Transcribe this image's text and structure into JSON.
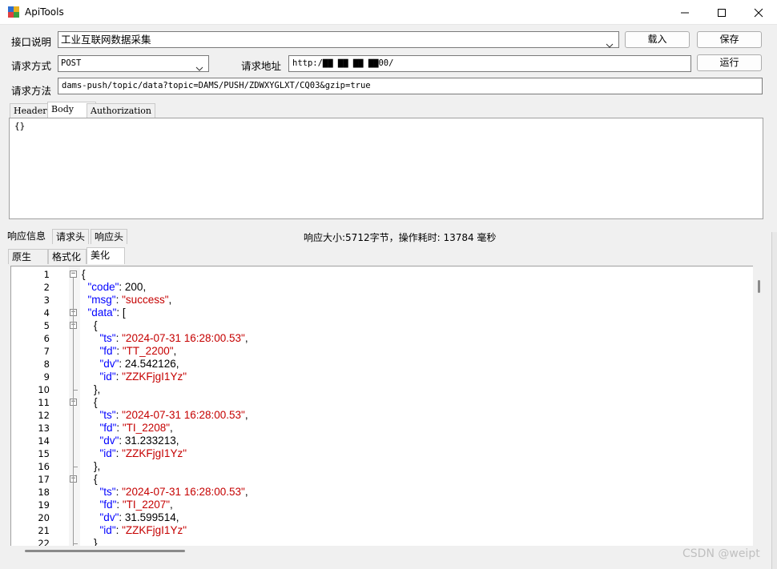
{
  "window": {
    "title": "ApiTools",
    "controls": [
      "minimize-icon",
      "maximize-icon",
      "close-icon"
    ]
  },
  "form": {
    "interface_desc_label": "接口说明",
    "interface_desc_value": "工业互联网数据采集",
    "method_label": "请求方式",
    "method_value": "POST",
    "url_label": "请求地址",
    "url_value": "http:/▇▇ ▇▇ ▇▇ ▇▇00/",
    "path_label": "请求方法",
    "path_value": "dams-push/topic/data?topic=DAMS/PUSH/ZDWXYGLXT/CQ03&gzip=true",
    "load_button": "载入",
    "save_button": "保存",
    "run_button": "运行"
  },
  "request_tabs": [
    {
      "label": "Header",
      "active": false
    },
    {
      "label": "Body",
      "active": true
    },
    {
      "label": "Authorization",
      "active": false
    }
  ],
  "request_body": "{}",
  "response_tabs": [
    {
      "label": "响应信息",
      "active": true
    },
    {
      "label": "请求头",
      "active": false
    },
    {
      "label": "响应头",
      "active": false
    }
  ],
  "response_status": "响应大小:5712字节，操作耗时: 13784 毫秒",
  "view_tabs": [
    {
      "label": "原生",
      "active": false
    },
    {
      "label": "格式化",
      "active": false
    },
    {
      "label": "美化",
      "active": true
    }
  ],
  "code_lines": [
    {
      "n": "1",
      "text": "{"
    },
    {
      "n": "2",
      "text": "  \"code\": 200,"
    },
    {
      "n": "3",
      "text": "  \"msg\": \"success\","
    },
    {
      "n": "4",
      "text": "  \"data\": ["
    },
    {
      "n": "5",
      "text": "    {"
    },
    {
      "n": "6",
      "text": "      \"ts\": \"2024-07-31 16:28:00.53\","
    },
    {
      "n": "7",
      "text": "      \"fd\": \"TT_2200\","
    },
    {
      "n": "8",
      "text": "      \"dv\": 24.542126,"
    },
    {
      "n": "9",
      "text": "      \"id\": \"ZZKFjgI1Yz\""
    },
    {
      "n": "10",
      "text": "    },"
    },
    {
      "n": "11",
      "text": "    {"
    },
    {
      "n": "12",
      "text": "      \"ts\": \"2024-07-31 16:28:00.53\","
    },
    {
      "n": "13",
      "text": "      \"fd\": \"TI_2208\","
    },
    {
      "n": "14",
      "text": "      \"dv\": 31.233213,"
    },
    {
      "n": "15",
      "text": "      \"id\": \"ZZKFjgI1Yz\""
    },
    {
      "n": "16",
      "text": "    },"
    },
    {
      "n": "17",
      "text": "    {"
    },
    {
      "n": "18",
      "text": "      \"ts\": \"2024-07-31 16:28:00.53\","
    },
    {
      "n": "19",
      "text": "      \"fd\": \"TI_2207\","
    },
    {
      "n": "20",
      "text": "      \"dv\": 31.599514,"
    },
    {
      "n": "21",
      "text": "      \"id\": \"ZZKFjgI1Yz\""
    },
    {
      "n": "22",
      "text": "    }"
    }
  ],
  "watermark": "CSDN @weipt",
  "colors": {
    "json_key": "#0000ff",
    "json_string": "#c50000",
    "background": "#f0f0f0"
  }
}
